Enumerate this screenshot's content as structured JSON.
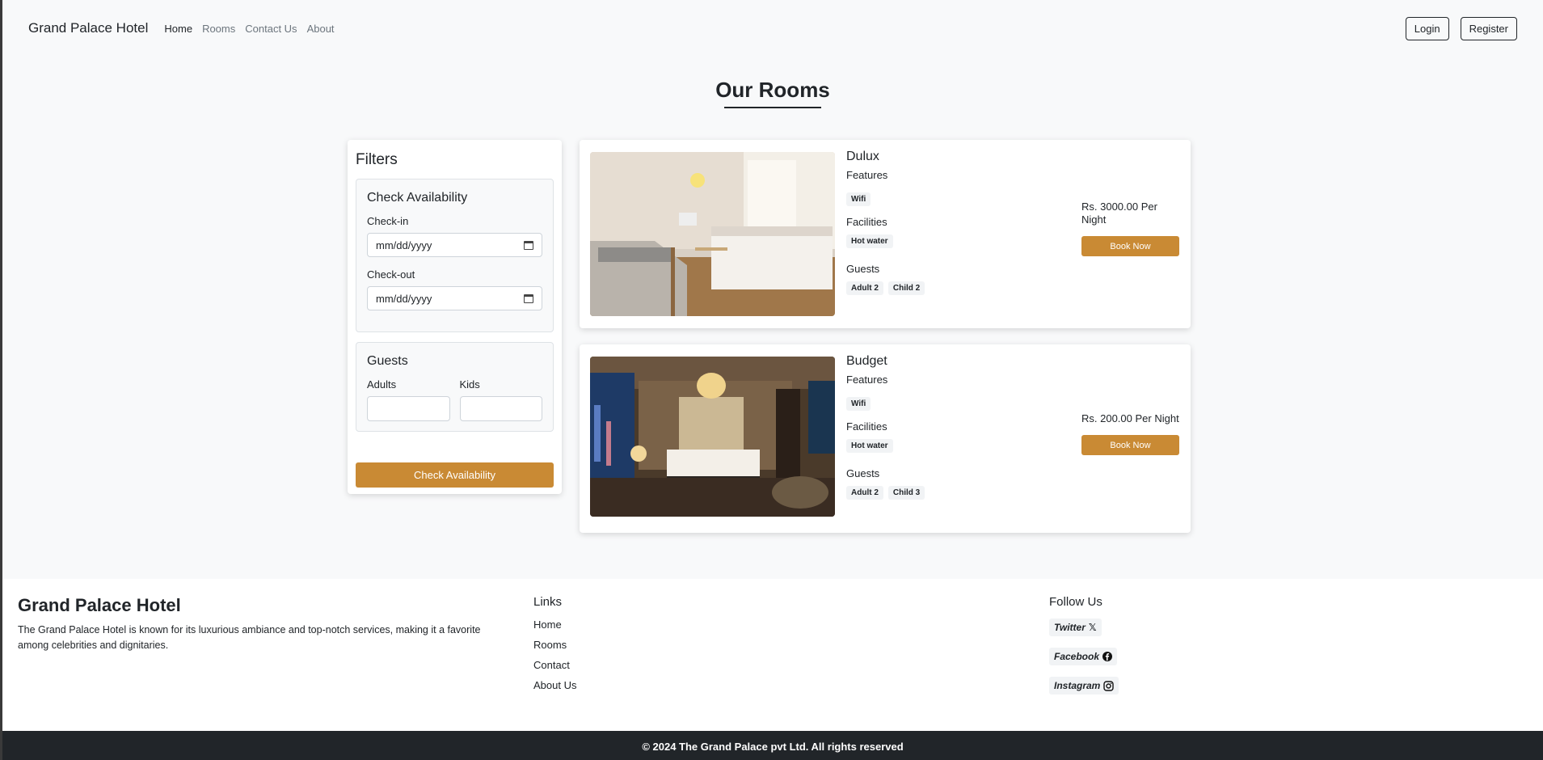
{
  "navbar": {
    "brand": "Grand Palace Hotel",
    "links": [
      "Home",
      "Rooms",
      "Contact Us",
      "About"
    ],
    "login": "Login",
    "register": "Register"
  },
  "page": {
    "title": "Our Rooms"
  },
  "filters": {
    "title": "Filters",
    "availability": {
      "title": "Check Availability",
      "checkin_label": "Check-in",
      "checkin_placeholder": "mm/dd/yyyy",
      "checkout_label": "Check-out",
      "checkout_placeholder": "mm/dd/yyyy"
    },
    "guests": {
      "title": "Guests",
      "adults_label": "Adults",
      "kids_label": "Kids"
    },
    "button": "Check Availability"
  },
  "rooms": [
    {
      "name": "Dulux",
      "features_label": "Features",
      "features": [
        "Wifi"
      ],
      "facilities_label": "Facilities",
      "facilities": [
        "Hot water"
      ],
      "guests_label": "Guests",
      "guests": [
        "Adult 2",
        "Child 2"
      ],
      "price": "Rs. 3000.00 Per Night",
      "book": "Book Now"
    },
    {
      "name": "Budget",
      "features_label": "Features",
      "features": [
        "Wifi"
      ],
      "facilities_label": "Facilities",
      "facilities": [
        "Hot water"
      ],
      "guests_label": "Guests",
      "guests": [
        "Adult 2",
        "Child 3"
      ],
      "price": "Rs. 200.00 Per Night",
      "book": "Book Now"
    }
  ],
  "footer": {
    "brand": "Grand Palace Hotel",
    "description": "The Grand Palace Hotel is known for its luxurious ambiance and top-notch services, making it a favorite among celebrities and dignitaries.",
    "links_title": "Links",
    "links": [
      "Home",
      "Rooms",
      "Contact",
      "About Us"
    ],
    "follow_title": "Follow Us",
    "socials": [
      "Twitter",
      "Facebook",
      "Instagram"
    ],
    "copyright": "© 2024 The Grand Palace pvt Ltd. All rights reserved"
  },
  "colors": {
    "accent": "#c98a34",
    "dark": "#212529"
  }
}
